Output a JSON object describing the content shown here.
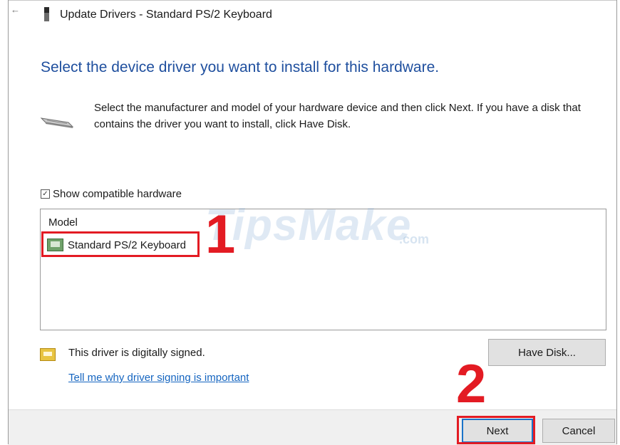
{
  "window": {
    "title": "Update Drivers - Standard PS/2 Keyboard",
    "back_glyph": "←"
  },
  "main": {
    "heading": "Select the device driver you want to install for this hardware.",
    "description": "Select the manufacturer and model of your hardware device and then click Next. If you have a disk that contains the driver you want to install, click Have Disk.",
    "device_icon": "keyboard-icon"
  },
  "compat": {
    "label": "Show compatible hardware",
    "checked": true
  },
  "model_list": {
    "header": "Model",
    "items": [
      {
        "label": "Standard PS/2 Keyboard",
        "icon": "hardware-icon",
        "selected": true
      }
    ]
  },
  "signing": {
    "status": "This driver is digitally signed.",
    "link": "Tell me why driver signing is important",
    "icon": "certificate-icon"
  },
  "buttons": {
    "have_disk": "Have Disk...",
    "next": "Next",
    "cancel": "Cancel"
  },
  "annotations": {
    "step1": "1",
    "step2": "2",
    "highlight_color": "#e31b23"
  },
  "watermark": {
    "text": "TipsMake",
    "suffix": ".com"
  },
  "colors": {
    "heading": "#1f4f9e",
    "link": "#1565c0",
    "footer_bg": "#f0f0f0",
    "button_bg": "#e1e1e1",
    "focus_border": "#1a73c8"
  }
}
